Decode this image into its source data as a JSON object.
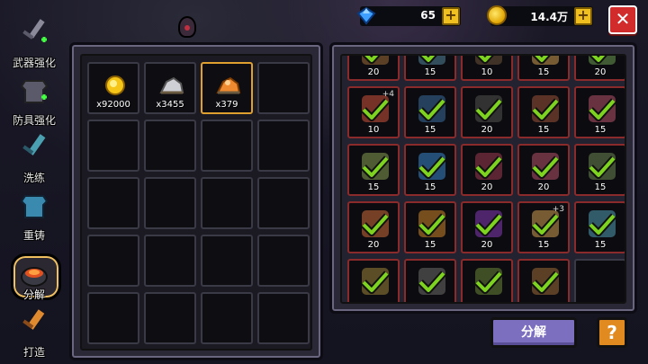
{
  "resources": {
    "gems": "65",
    "gold": "14.4万"
  },
  "sidebar": {
    "items": [
      {
        "label": "武器强化",
        "icon": "sword-upgrade-icon"
      },
      {
        "label": "防具强化",
        "icon": "armor-upgrade-icon"
      },
      {
        "label": "洗练",
        "icon": "refine-icon"
      },
      {
        "label": "重铸",
        "icon": "recast-icon"
      },
      {
        "label": "分解",
        "icon": "decompose-icon",
        "active": true
      },
      {
        "label": "打造",
        "icon": "forge-icon"
      }
    ]
  },
  "materials": [
    {
      "name": "gold-coin",
      "count": "x92000"
    },
    {
      "name": "silver-ore",
      "count": "x3455"
    },
    {
      "name": "orange-ore",
      "count": "x379",
      "selected": true
    }
  ],
  "material_grid": {
    "rows": 5,
    "cols": 4
  },
  "equipment": [
    {
      "level": "20",
      "color": "#6a4a2a"
    },
    {
      "level": "15",
      "color": "#3a5a6a"
    },
    {
      "level": "10",
      "color": "#4a3a2a"
    },
    {
      "level": "15",
      "color": "#8a6a3a"
    },
    {
      "level": "20",
      "color": "#4a6a3a"
    },
    {
      "level": "10",
      "color": "#8a3a2a",
      "plus": "+4"
    },
    {
      "level": "15",
      "color": "#2a4a6a"
    },
    {
      "level": "20",
      "color": "#3a3a3a"
    },
    {
      "level": "15",
      "color": "#6a3a2a"
    },
    {
      "level": "15",
      "color": "#7a3a4a"
    },
    {
      "level": "15",
      "color": "#5a6a3a"
    },
    {
      "level": "15",
      "color": "#2a5a8a"
    },
    {
      "level": "20",
      "color": "#6a2a3a"
    },
    {
      "level": "20",
      "color": "#7a3a4a"
    },
    {
      "level": "15",
      "color": "#4a5a3a"
    },
    {
      "level": "20",
      "color": "#8a4a2a"
    },
    {
      "level": "15",
      "color": "#8a5a20"
    },
    {
      "level": "20",
      "color": "#5a2a7a"
    },
    {
      "level": "15",
      "color": "#8a6a3a",
      "plus": "+3"
    },
    {
      "level": "15",
      "color": "#3a6a7a"
    },
    {
      "level": "",
      "color": "#6a5a2a"
    },
    {
      "level": "",
      "color": "#4a4a4a"
    },
    {
      "level": "",
      "color": "#4a5a2a"
    },
    {
      "level": "",
      "color": "#6a4a2a"
    },
    {
      "level": "",
      "color": "",
      "empty": true
    }
  ],
  "buttons": {
    "decompose": "分解",
    "help": "?",
    "close": "✕",
    "plus": "+"
  },
  "colors": {
    "check": "#7ed321",
    "accent_border": "#e0a030",
    "button_purple": "#7c6fc0"
  }
}
